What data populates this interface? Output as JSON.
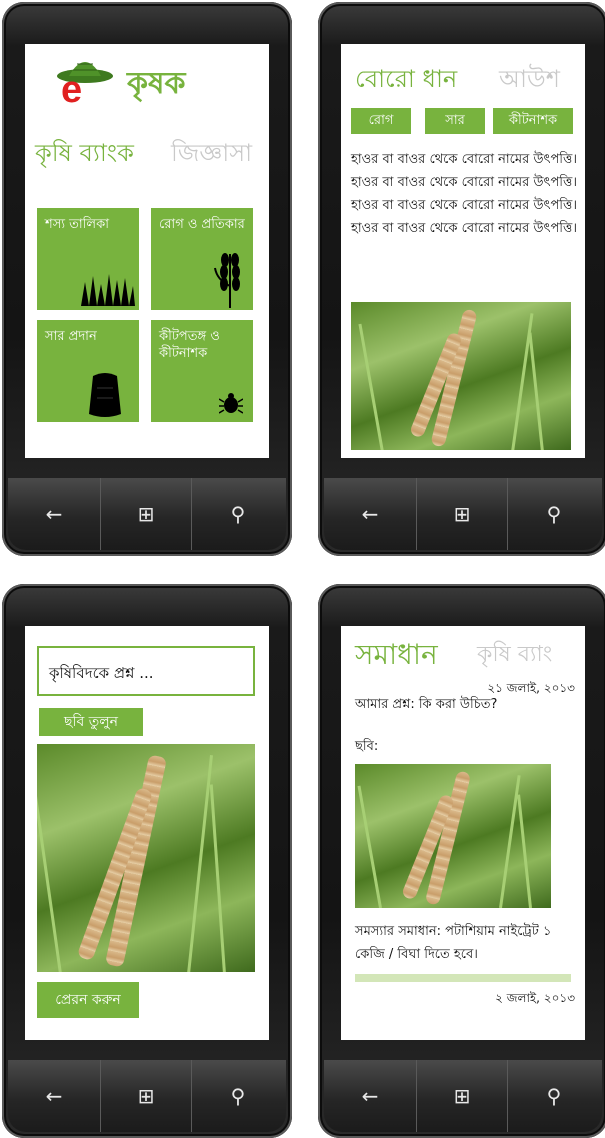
{
  "phone1": {
    "app_title": "কৃষক",
    "logo_letter": "e",
    "section_title": "কৃষি ব্যাংক",
    "section_ghost": "জিজ্ঞাসা",
    "tiles": [
      {
        "label": "শস্য তালিকা",
        "icon": "grass-icon"
      },
      {
        "label": "রোগ ও প্রতিকার",
        "icon": "wheat-icon"
      },
      {
        "label": "সার প্রদান",
        "icon": "fertilizer-bag-icon"
      },
      {
        "label": "কীটপতঙ্গ ও কীটনাশক",
        "icon": "bug-icon"
      }
    ]
  },
  "phone2": {
    "title": "বোরো ধান",
    "title_ghost": "আউশ",
    "tabs": [
      "রোগ",
      "সার",
      "কীটনাশক"
    ],
    "body": "হাওর বা বাওর থেকে বোরো নামের উৎপত্তি। হাওর বা বাওর থেকে বোরো নামের উৎপত্তি। হাওর বা বাওর থেকে বোরো নামের উৎপত্তি। হাওর বা বাওর থেকে বোরো নামের উৎপত্তি।"
  },
  "phone3": {
    "input_value": "কৃষিবিদকে প্রশ্ন ...",
    "photo_button": "ছবি তুলুন",
    "send_button": "প্রেরন করুন"
  },
  "phone4": {
    "title": "সমাধান",
    "title_ghost": "কৃষি ব্যাং",
    "date1": "২১ জলাই, ২০১৩",
    "question": "আমার প্রশ্ন: কি করা উচিত?",
    "photo_label": "ছবি:",
    "answer": "সমস্যার সমাধান: পটাশিয়াম নাইট্রেট ১ কেজি / বিঘা দিতে হবে।",
    "date2": "২ জলাই, ২০১৩"
  },
  "hardware": {
    "back_symbol": "←",
    "windows_symbol": "⊞",
    "search_symbol": "⚲"
  },
  "colors": {
    "accent": "#78b33e",
    "ghost_text": "#c9c9c9",
    "logo_red": "#e02020",
    "progress_track": "#d3e6b8"
  }
}
